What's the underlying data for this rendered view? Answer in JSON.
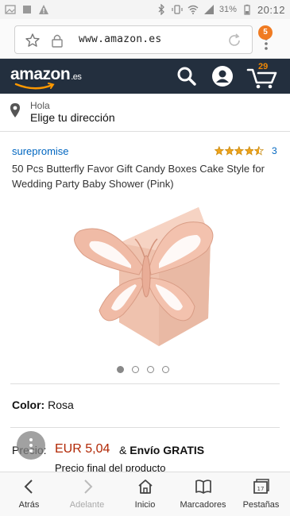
{
  "status_bar": {
    "battery": "31%",
    "time": "20:12",
    "left_icons": [
      "gallery-icon",
      "square-icon",
      "warning-icon"
    ],
    "right_icons": [
      "bluetooth-icon",
      "vibrate-icon",
      "wifi-icon",
      "signal-icon",
      "battery-icon"
    ]
  },
  "browser": {
    "url": "www.amazon.es",
    "tab_count": "5"
  },
  "header": {
    "logo_text": "amazon",
    "logo_tld": ".es",
    "cart_count": "29",
    "bg_color": "#232f3e",
    "accent_color": "#f08804"
  },
  "location": {
    "greeting": "Hola",
    "prompt": "Elige tu dirección"
  },
  "product": {
    "brand": "surepromise",
    "rating": 4.5,
    "review_count": "3",
    "title": "50 Pcs Butterfly Favor Gift Candy Boxes Cake Style for Wedding Party Baby Shower (Pink)",
    "image_icon": "butterfly-cake-box-image",
    "image_count": 4,
    "active_image": 0
  },
  "color": {
    "label": "Color:",
    "value": "Rosa"
  },
  "price": {
    "label": "Precio:",
    "value": "EUR 5,04",
    "shipping_prefix": "&",
    "shipping": "Envío GRATIS",
    "note": "Precio final del producto"
  },
  "bottom_nav": [
    {
      "label": "Atrás",
      "icon": "back-arrow-icon"
    },
    {
      "label": "Adelante",
      "icon": "forward-arrow-icon"
    },
    {
      "label": "Inicio",
      "icon": "home-icon"
    },
    {
      "label": "Marcadores",
      "icon": "bookmarks-icon"
    },
    {
      "label": "Pestañas",
      "icon": "tabs-icon"
    }
  ]
}
